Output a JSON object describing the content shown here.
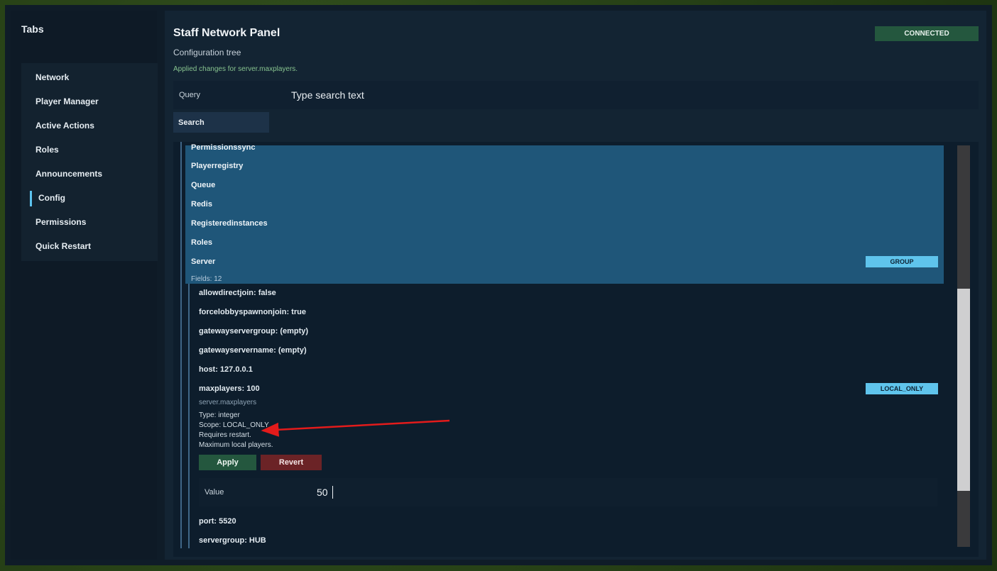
{
  "sidebar": {
    "title": "Tabs",
    "items": [
      {
        "label": "Network"
      },
      {
        "label": "Player Manager"
      },
      {
        "label": "Active Actions"
      },
      {
        "label": "Roles"
      },
      {
        "label": "Announcements"
      },
      {
        "label": "Config",
        "active": true
      },
      {
        "label": "Permissions"
      },
      {
        "label": "Quick Restart"
      }
    ]
  },
  "header": {
    "title": "Staff Network Panel",
    "subtitle": "Configuration tree",
    "status_message": "Applied changes for server.maxplayers.",
    "connection_status": "CONNECTED"
  },
  "search": {
    "label": "Query",
    "placeholder": "Type search text",
    "button": "Search"
  },
  "tree": {
    "groups": [
      {
        "label": "Permissionssync"
      },
      {
        "label": "Playerregistry"
      },
      {
        "label": "Queue"
      },
      {
        "label": "Redis"
      },
      {
        "label": "Registeredinstances"
      },
      {
        "label": "Roles"
      },
      {
        "label": "Server",
        "badge": "GROUP",
        "fields": "Fields: 12"
      }
    ],
    "fields": [
      {
        "label": "allowdirectjoin: false"
      },
      {
        "label": "forcelobbyspawnonjoin: true"
      },
      {
        "label": "gatewayservergroup: (empty)"
      },
      {
        "label": "gatewayservername: (empty)"
      },
      {
        "label": "host: 127.0.0.1"
      },
      {
        "label": "maxplayers: 100",
        "badge": "LOCAL_ONLY",
        "path": "server.maxplayers",
        "type": "Type: integer",
        "scope": "Scope: LOCAL_ONLY",
        "restart": "Requires restart.",
        "description": "Maximum local players.",
        "apply": "Apply",
        "revert": "Revert",
        "value_label": "Value",
        "value": "50"
      },
      {
        "label": "port: 5520"
      },
      {
        "label": "servergroup: HUB"
      }
    ]
  },
  "colors": {
    "accent": "#5cc3ef",
    "connected": "#24573e",
    "revert": "#6b2326",
    "group_highlight": "#1f5679",
    "annotation_arrow": "#e31b1b"
  }
}
